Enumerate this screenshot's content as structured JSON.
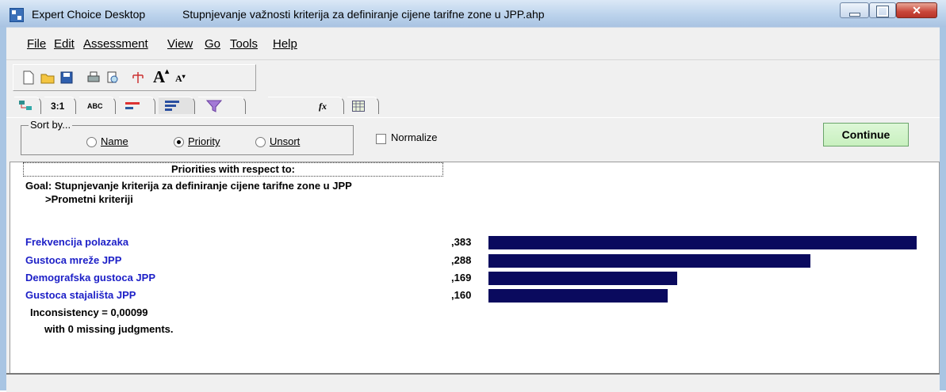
{
  "window": {
    "app_name": "Expert Choice Desktop",
    "file_title": "Stupnjevanje važnosti kriterija za definiranje cijene tarifne zone u JPP.ahp"
  },
  "menu": {
    "file": "File",
    "edit": "Edit",
    "assessment": "Assessment",
    "view": "View",
    "go": "Go",
    "tools": "Tools",
    "help": "Help"
  },
  "tabs": {
    "pairwise": "3:1",
    "verbal": "ABC",
    "formula": "fx"
  },
  "sort": {
    "legend": "Sort by...",
    "name": "Name",
    "priority": "Priority",
    "unsort": "Unsort",
    "selected": "Priority"
  },
  "normalize_label": "Normalize",
  "normalize_checked": false,
  "continue_label": "Continue",
  "results": {
    "header": "Priorities with respect to:",
    "goal": "Goal: Stupnjevanje kriterija za definiranje cijene tarifne zone u JPP",
    "node": ">Prometni kriteriji",
    "bar_color": "#0a0a5e",
    "criteria": [
      {
        "name": "Frekvencija polazaka",
        "value_label": ",383",
        "value": 0.383
      },
      {
        "name": "Gustoca mreže JPP",
        "value_label": ",288",
        "value": 0.288
      },
      {
        "name": "Demografska gustoca JPP",
        "value_label": ",169",
        "value": 0.169
      },
      {
        "name": "Gustoca stajališta JPP",
        "value_label": ",160",
        "value": 0.16
      }
    ],
    "inconsistency": "Inconsistency = 0,00099",
    "missing": "with 0  missing judgments."
  }
}
